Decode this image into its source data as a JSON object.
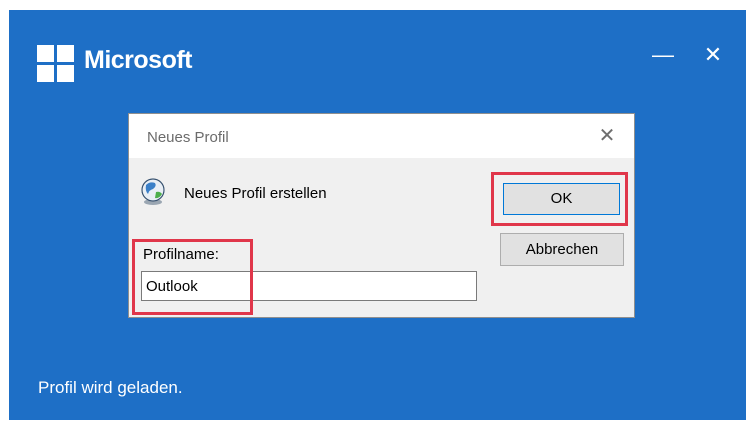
{
  "splash": {
    "brand": "Microsoft",
    "minimize_glyph": "—",
    "close_glyph": "✕",
    "status": "Profil wird geladen.",
    "background_color": "#1e6fc6"
  },
  "dialog": {
    "title": "Neues Profil",
    "close_glyph": "✕",
    "heading": "Neues Profil erstellen",
    "ok_label": "OK",
    "cancel_label": "Abbrechen",
    "profile_label": "Profilname:",
    "profile_value": "Outlook"
  },
  "highlight_color": "#e0364a"
}
